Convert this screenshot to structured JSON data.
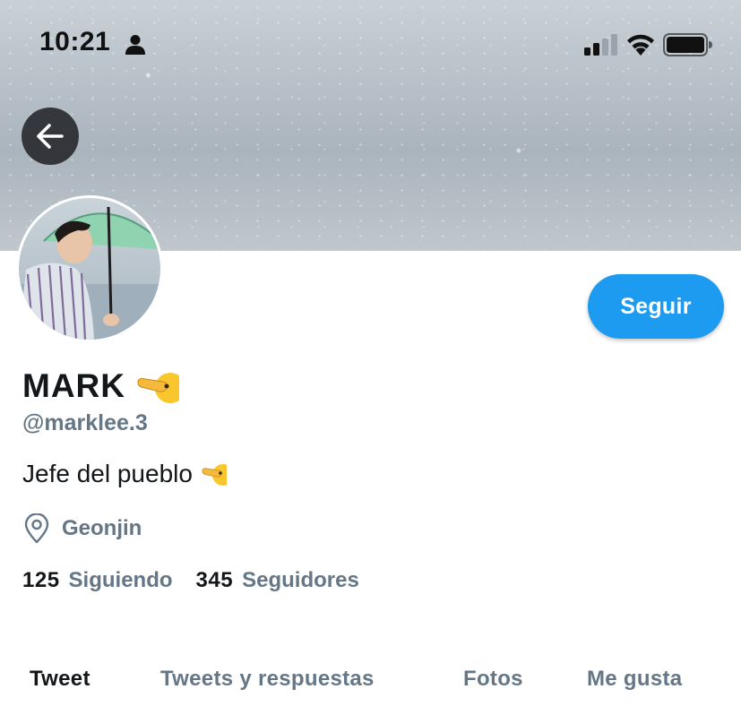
{
  "status_bar": {
    "time": "10:21",
    "icons": [
      "person-icon",
      "signal-icon",
      "wifi-icon",
      "battery-icon"
    ]
  },
  "header": {
    "back_icon": "arrow-left-icon"
  },
  "profile": {
    "display_name": "MARK",
    "handle": "@marklee.3",
    "bio": "Jefe del pueblo",
    "location": "Geonjin",
    "following_count": "125",
    "following_label": "Siguiendo",
    "followers_count": "345",
    "followers_label": "Seguidores",
    "follow_button_label": "Seguir"
  },
  "tabs": [
    {
      "label": "Tweet",
      "active": true
    },
    {
      "label": "Tweets y respuestas",
      "active": false
    },
    {
      "label": "Fotos",
      "active": false
    },
    {
      "label": "Me gusta",
      "active": false
    }
  ],
  "colors": {
    "accent": "#1d9bf0",
    "secondary_text": "#657786",
    "primary_text": "#14171a"
  }
}
